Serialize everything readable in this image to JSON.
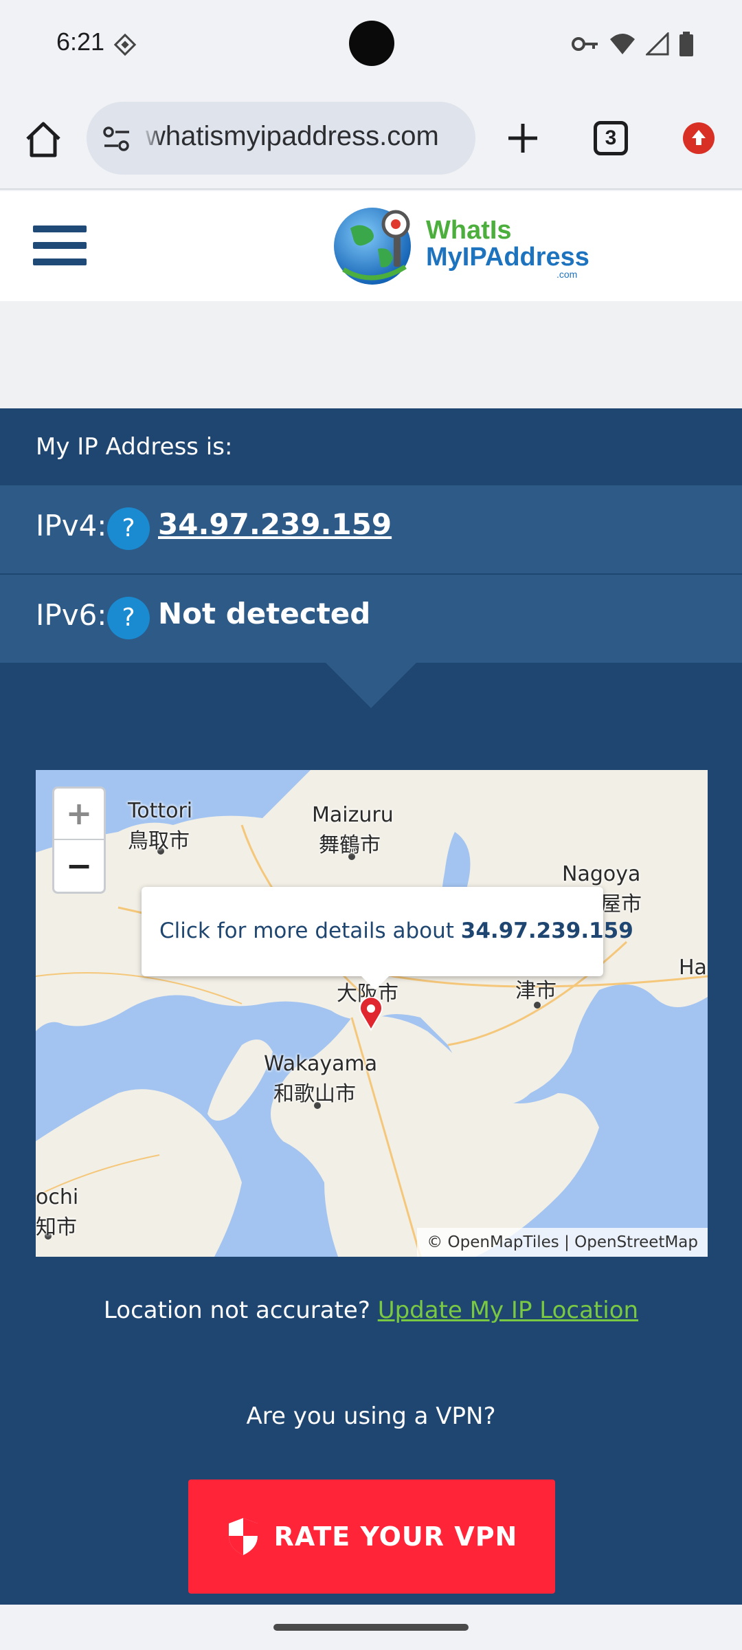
{
  "status_bar": {
    "time": "6:21"
  },
  "browser": {
    "url": "whatismyipaddress.com",
    "tab_count": "3"
  },
  "site": {
    "logo_line1": "WhatIs",
    "logo_line2": "MyIPAddress",
    "logo_line3": ".com"
  },
  "ip_panel": {
    "heading": "My IP Address is:",
    "ipv4_label": "IPv4:",
    "ipv4_value": "34.97.239.159",
    "ipv6_label": "IPv6:",
    "ipv6_value": "Not detected",
    "help_symbol": "?"
  },
  "map": {
    "zoom_in": "+",
    "zoom_out": "−",
    "popup_prefix": "Click for more details about",
    "popup_ip": "34.97.239.159",
    "attribution": "© OpenMapTiles | OpenStreetMap",
    "labels": {
      "tottori_en": "Tottori",
      "tottori_ja": "鳥取市",
      "maizuru_en": "Maizuru",
      "maizuru_ja": "舞鶴市",
      "nagoya_en": "Nagoya",
      "nagoya_ja": "屋市",
      "osaka_ja": "大阪市",
      "tsu_ja": "津市",
      "wakayama_en": "Wakayama",
      "wakayama_ja": "和歌山市",
      "kochi_en": "ochi",
      "kochi_ja": "知市",
      "ha_en": "Ha"
    }
  },
  "location": {
    "question": "Location not accurate?",
    "link": "Update My IP Location"
  },
  "vpn": {
    "question": "Are you using a VPN?",
    "button_label": "RATE YOUR VPN"
  },
  "colors": {
    "panel_bg": "#1f4670",
    "row_bg": "#2d5a86",
    "accent_green": "#7ac943",
    "vpn_red": "#ff2438"
  }
}
